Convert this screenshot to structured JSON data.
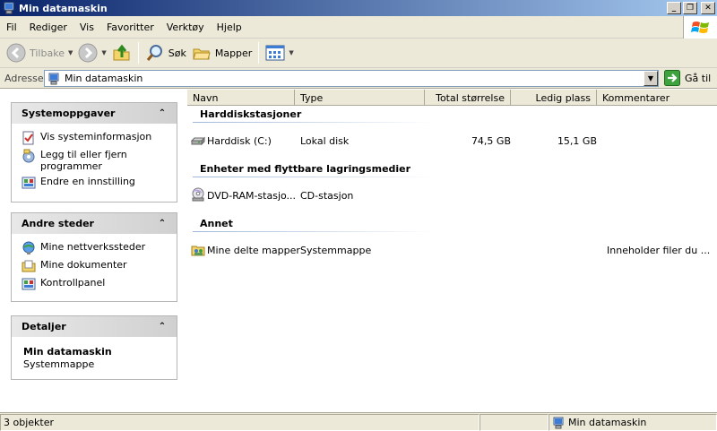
{
  "window": {
    "title": "Min datamaskin"
  },
  "menu": [
    "Fil",
    "Rediger",
    "Vis",
    "Favoritter",
    "Verktøy",
    "Hjelp"
  ],
  "toolbar": {
    "back_label": "Tilbake",
    "search_label": "Søk",
    "folders_label": "Mapper"
  },
  "address": {
    "label": "Adresse",
    "value": "Min datamaskin",
    "go_label": "Gå til"
  },
  "tasks": {
    "system": {
      "title": "Systemoppgaver",
      "items": [
        {
          "label": "Vis systeminformasjon",
          "icon": "system-info-icon"
        },
        {
          "label": "Legg til eller fjern programmer",
          "icon": "add-remove-programs-icon"
        },
        {
          "label": "Endre en innstilling",
          "icon": "control-panel-icon"
        }
      ]
    },
    "places": {
      "title": "Andre steder",
      "items": [
        {
          "label": "Mine nettverkssteder",
          "icon": "network-places-icon"
        },
        {
          "label": "Mine dokumenter",
          "icon": "my-documents-icon"
        },
        {
          "label": "Kontrollpanel",
          "icon": "control-panel-icon"
        }
      ]
    },
    "details": {
      "title": "Detaljer",
      "name": "Min datamaskin",
      "type": "Systemmappe"
    }
  },
  "columns": [
    "Navn",
    "Type",
    "Total størrelse",
    "Ledig plass",
    "Kommentarer"
  ],
  "groups": [
    {
      "title": "Harddiskstasjoner",
      "items": [
        {
          "name": "Harddisk (C:)",
          "type": "Lokal disk",
          "total": "74,5 GB",
          "free": "15,1 GB",
          "comment": "",
          "icon": "hard-disk-icon"
        }
      ]
    },
    {
      "title": "Enheter med flyttbare lagringsmedier",
      "items": [
        {
          "name": "DVD-RAM-stasjo...",
          "type": "CD-stasjon",
          "total": "",
          "free": "",
          "comment": "",
          "icon": "dvd-drive-icon"
        }
      ]
    },
    {
      "title": "Annet",
      "items": [
        {
          "name": "Mine delte mapper",
          "type": "Systemmappe",
          "total": "",
          "free": "",
          "comment": "Inneholder filer du ...",
          "icon": "shared-folder-icon"
        }
      ]
    }
  ],
  "status": {
    "count": "3 objekter",
    "location": "Min datamaskin"
  }
}
